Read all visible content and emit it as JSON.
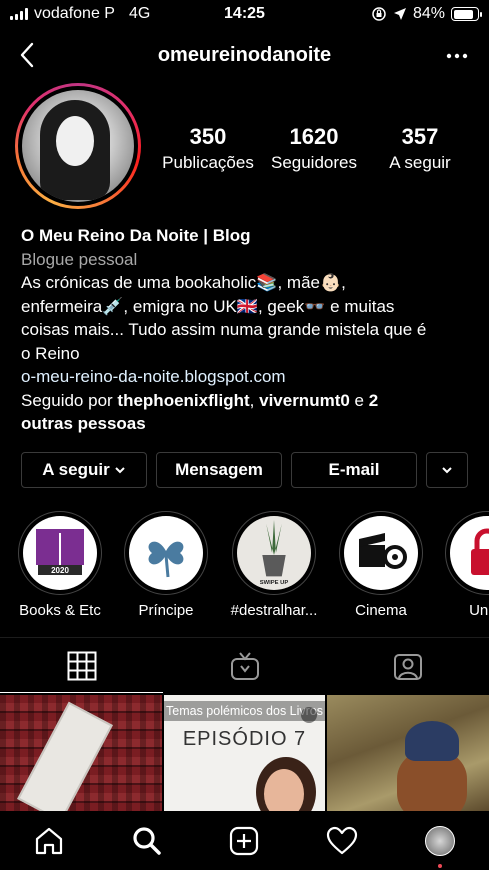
{
  "status": {
    "carrier": "vodafone P",
    "network": "4G",
    "time": "14:25",
    "battery": "84%",
    "battery_level": 0.84,
    "icons": [
      "signal-icon",
      "lock-rotation-icon",
      "location-arrow-icon",
      "battery-icon"
    ]
  },
  "header": {
    "username": "omeureinodanoite",
    "back_icon": "chevron-left-icon",
    "more_icon": "more-dots-icon"
  },
  "stats": [
    {
      "value": "350",
      "label": "Publicações"
    },
    {
      "value": "1620",
      "label": "Seguidores"
    },
    {
      "value": "357",
      "label": "A seguir"
    }
  ],
  "bio": {
    "name": "O Meu Reino Da Noite | Blog",
    "category": "Blogue pessoal",
    "text_1": "As crónicas de uma bookaholic📚, mãe👶🏻,",
    "text_2": "enfermeira💉, emigra no UK🇬🇧, geek👓 e muitas",
    "text_3": "coisas mais... Tudo assim numa grande mistela que é",
    "text_4": "o Reino",
    "link": "o-meu-reino-da-noite.blogspot.com",
    "followed_prefix": "Seguido por",
    "followed_user_1": "thephoenixflight",
    "followed_sep": ",",
    "followed_user_2": "vivernumt0",
    "followed_and": "e",
    "followed_others_1": "2",
    "followed_others_2": "outras pessoas"
  },
  "buttons": {
    "following": "A seguir",
    "message": "Mensagem",
    "email": "E-mail"
  },
  "highlights": [
    {
      "label": "Books & Etc",
      "badge": "2020"
    },
    {
      "label": "Príncipe"
    },
    {
      "label": "#destralhar...",
      "badge": "SWIPE UP"
    },
    {
      "label": "Cinema"
    },
    {
      "label": "Unbo"
    }
  ],
  "tabs": [
    {
      "icon": "grid-icon",
      "active": true
    },
    {
      "icon": "igtv-icon",
      "active": false
    },
    {
      "icon": "tagged-icon",
      "active": false
    }
  ],
  "posts": [
    {
      "caption": ""
    },
    {
      "banner": "Temas polémicos dos Livros",
      "title": "EPISÓDIO 7"
    },
    {
      "caption": ""
    }
  ],
  "bottom_nav": [
    {
      "icon": "home-icon"
    },
    {
      "icon": "search-icon"
    },
    {
      "icon": "add-post-icon"
    },
    {
      "icon": "heart-icon"
    },
    {
      "icon": "profile-avatar"
    }
  ],
  "colors": {
    "background": "#000000",
    "notification": "#ed4956",
    "link": "#e0f1ff",
    "secondary": "#a8a8a8"
  }
}
